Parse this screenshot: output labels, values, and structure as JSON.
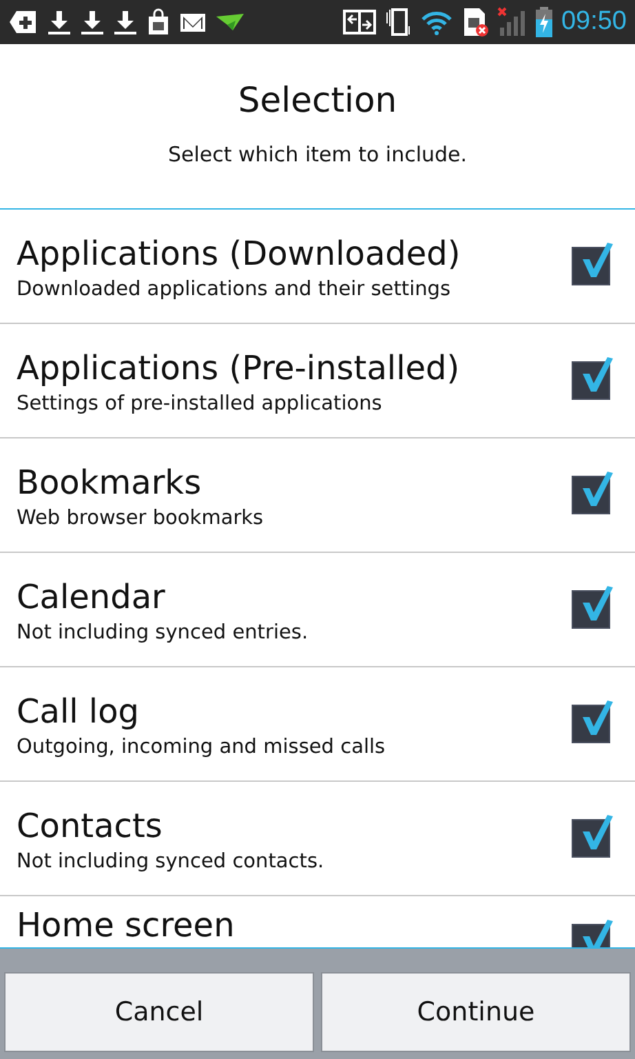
{
  "status_bar": {
    "time": "09:50"
  },
  "header": {
    "title": "Selection",
    "subtitle": "Select which item to include."
  },
  "items": [
    {
      "title": "Applications (Downloaded)",
      "description": "Downloaded applications and their settings",
      "checked": true
    },
    {
      "title": "Applications (Pre-installed)",
      "description": "Settings of pre-installed applications",
      "checked": true
    },
    {
      "title": "Bookmarks",
      "description": "Web browser bookmarks",
      "checked": true
    },
    {
      "title": "Calendar",
      "description": "Not including synced entries.",
      "checked": true
    },
    {
      "title": "Call log",
      "description": "Outgoing, incoming and missed calls",
      "checked": true
    },
    {
      "title": "Contacts",
      "description": "Not including synced contacts.",
      "checked": true
    },
    {
      "title": "Home screen",
      "checked": true
    }
  ],
  "buttons": [
    "Cancel",
    "Continue"
  ]
}
